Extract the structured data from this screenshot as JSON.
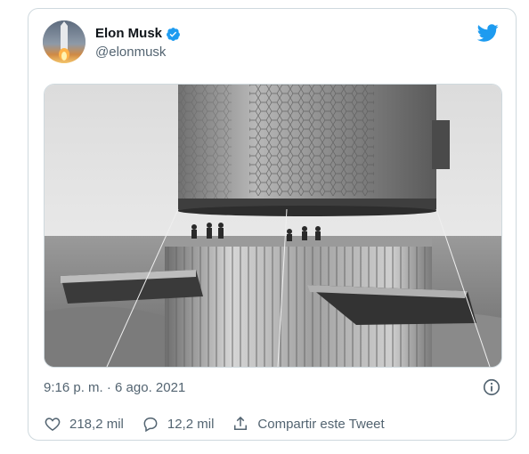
{
  "tweet": {
    "author": {
      "display_name": "Elon Musk",
      "handle": "@elonmusk",
      "verified": true,
      "avatar_icon": "avatar-image"
    },
    "timestamp": "9:16 p. m. · 6 ago. 2021",
    "media_icon": "photo-starship-booster-tower",
    "actions": {
      "like_count": "218,2 mil",
      "reply_count": "12,2 mil",
      "share_label": "Compartir este Tweet"
    },
    "brand_icon": "twitter-bird-icon",
    "colors": {
      "brand": "#1d9bf0",
      "muted_text": "#536471",
      "border": "#cfd9de"
    }
  }
}
